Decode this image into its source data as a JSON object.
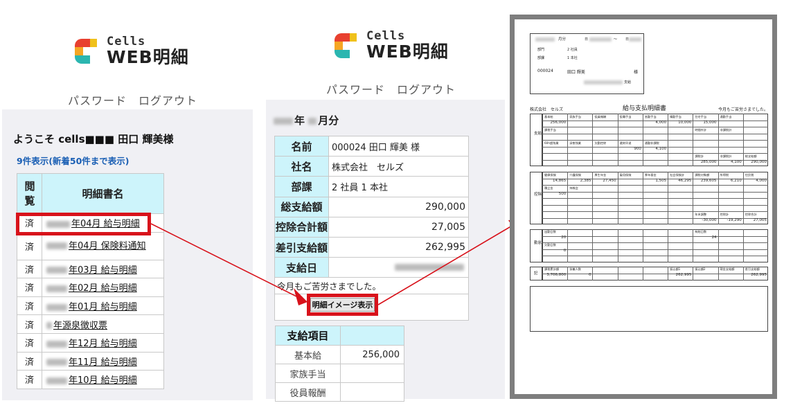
{
  "app": {
    "logo_line1": "Cells",
    "logo_line2": "WEB明細",
    "nav": "パスワード　ログアウト"
  },
  "list_page": {
    "welcome": "ようこそ cells■■■ 田口 輝美様",
    "count_text": "9件表示(新着50件まで表示)",
    "headers": [
      "閲覧",
      "明細書名"
    ],
    "rows": [
      {
        "status": "済",
        "title": "年04月 給与明細"
      },
      {
        "status": "済",
        "title": "年04月 保険料通知"
      },
      {
        "status": "済",
        "title": "年03月 給与明細"
      },
      {
        "status": "済",
        "title": "年02月 給与明細"
      },
      {
        "status": "済",
        "title": "年01月 給与明細"
      },
      {
        "status": "済",
        "title": "年源泉徴収票"
      },
      {
        "status": "済",
        "title": "年12月 給与明細"
      },
      {
        "status": "済",
        "title": "年11月 給与明細"
      },
      {
        "status": "済",
        "title": "年10月 給与明細"
      }
    ]
  },
  "detail_page": {
    "period_year": "年",
    "period_month": "月分",
    "fields": [
      {
        "label": "名前",
        "value": "000024 田口 輝美 様"
      },
      {
        "label": "社名",
        "value": "株式会社　セルズ"
      },
      {
        "label": "部課",
        "value": "2 社員 1 本社"
      },
      {
        "label": "総支給額",
        "value": "290,000"
      },
      {
        "label": "控除合計額",
        "value": "27,005"
      },
      {
        "label": "差引支給額",
        "value": "262,995"
      },
      {
        "label": "支給日",
        "value": ""
      }
    ],
    "message": "今月もご苦労さまでした。",
    "button": "明細イメージ表示",
    "pay_header": "支給項目",
    "pay_rows": [
      {
        "label": "基本給",
        "value": "256,000"
      },
      {
        "label": "家族手当",
        "value": ""
      },
      {
        "label": "役員報酬",
        "value": ""
      }
    ]
  },
  "payslip": {
    "header": {
      "period_suffix": "月分",
      "date_label": "日",
      "tilde": "～",
      "date_label2": "日",
      "dept_label": "部門",
      "dept_value": "2 社員",
      "section_label": "部課",
      "section_value": "1 本社",
      "employee_no": "000024",
      "employee_name": "田口 輝美",
      "honorific": "様",
      "paid_label": "支給"
    },
    "company": "株式会社　セルズ",
    "title": "給与支払明細書",
    "message": "今月もご苦労さまでした。",
    "sections": {
      "pay": "支給",
      "deduction": "控除",
      "attendance": "勤怠",
      "totals": "記"
    },
    "pay_labels_row1": [
      "基本給",
      "家族手当",
      "役員報酬",
      "役職手当",
      "皆勤手当",
      "精勤手当",
      "住宅手当",
      "通勤手当"
    ],
    "pay_values_row1": [
      "256,000",
      "",
      "",
      "",
      "4,000",
      "10,000",
      "15,000",
      ""
    ],
    "pay_labels_row2": [
      "課税手当",
      "",
      "",
      "",
      "",
      "",
      "時間外計",
      "非課税計"
    ],
    "pay_labels_row3": [
      "60h超残業",
      "深夜残業",
      "欠勤控除",
      "遅刻早退",
      "通勤非課税",
      ""
    ],
    "pay_values_row3": [
      "",
      "",
      "",
      "900",
      "4,100",
      ""
    ],
    "pay_totals_labels": [
      "課税計",
      "非課税計",
      "総支給額"
    ],
    "pay_totals": [
      "285,000",
      "4,100",
      "290,000"
    ],
    "ded_labels_row1": [
      "健康保険",
      "介護保険",
      "厚生年金",
      "雇用保険",
      "厚年基金",
      "社会保険計",
      "課税対象額",
      "所得税",
      "住民税"
    ],
    "ded_values_row1": [
      "14,865",
      "2,385",
      "27,450",
      "",
      "1,505",
      "46,295",
      "239,605",
      "6,210",
      "4,000"
    ],
    "ded_labels_row2": [
      "積立金",
      "持株会"
    ],
    "ded_values_row2": [
      "500",
      ""
    ],
    "ded_totals_labels": [
      "年末調整",
      "控除計",
      "控除合計"
    ],
    "ded_totals": [
      "-30,000",
      "-19,290",
      "27,005"
    ],
    "att_labels": [
      "出勤日数",
      "有給日数"
    ],
    "att_values": [
      "20",
      "24"
    ],
    "att_labels2": [
      "欠勤日数"
    ],
    "att_values2": [
      "0"
    ],
    "sum_labels": [
      "課税累計額",
      "扶養人数",
      "振込額1",
      "振込額2",
      "現金支給額",
      "差引支給額"
    ],
    "sum_values": [
      "3,706,800",
      "0",
      "262,995",
      "",
      "",
      "262,995"
    ]
  },
  "colors": {
    "header_cyan": "#cdf4fb",
    "highlight_red": "#d8121b",
    "panel_gray": "#f0f0f4",
    "link_blue": "#1a5fb4"
  }
}
